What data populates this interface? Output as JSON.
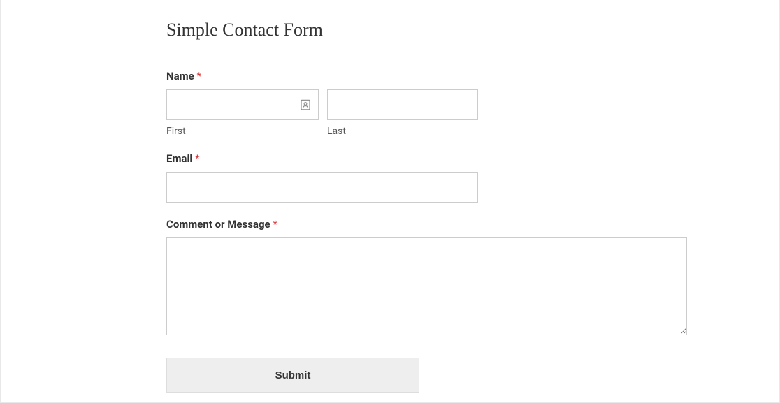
{
  "form": {
    "title": "Simple Contact Form",
    "fields": {
      "name": {
        "label": "Name",
        "required_mark": "*",
        "first_sublabel": "First",
        "last_sublabel": "Last",
        "first_value": "",
        "last_value": ""
      },
      "email": {
        "label": "Email",
        "required_mark": "*",
        "value": ""
      },
      "message": {
        "label": "Comment or Message",
        "required_mark": "*",
        "value": ""
      }
    },
    "submit_label": "Submit"
  }
}
